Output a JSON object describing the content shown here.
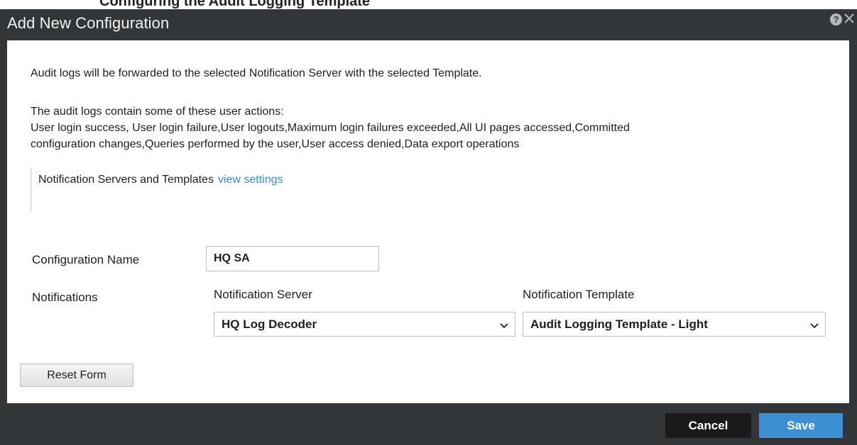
{
  "header_fragment": "Configuring the Audit Logging Template",
  "dialog": {
    "title": "Add New Configuration"
  },
  "content": {
    "intro": "Audit logs will be forwarded to the selected Notification Server with the selected Template.",
    "actions_heading": "The audit logs contain some of these user actions:",
    "actions_line1": "User login success, User login failure,User logouts,Maximum login failures exceeded,All UI pages accessed,Committed",
    "actions_line2": "configuration changes,Queries performed by the user,User access denied,Data export operations",
    "ns_label": "Notification Servers and Templates",
    "ns_link": "view settings"
  },
  "form": {
    "config_name_label": "Configuration Name",
    "config_name_value": "HQ SA",
    "notifications_label": "Notifications",
    "server_label": "Notification Server",
    "server_value": "HQ Log Decoder",
    "template_label": "Notification Template",
    "template_value": "Audit Logging Template - Light",
    "reset_label": "Reset Form"
  },
  "footer": {
    "cancel_label": "Cancel",
    "save_label": "Save"
  },
  "colors": {
    "dialog_bg": "#333638",
    "link": "#2e8fd6",
    "save_bg": "#3d8fd4",
    "cancel_bg": "#1a1a1a"
  },
  "icons": {
    "help": "help-icon",
    "close": "close-icon",
    "dropdown": "chevron-down-icon"
  }
}
